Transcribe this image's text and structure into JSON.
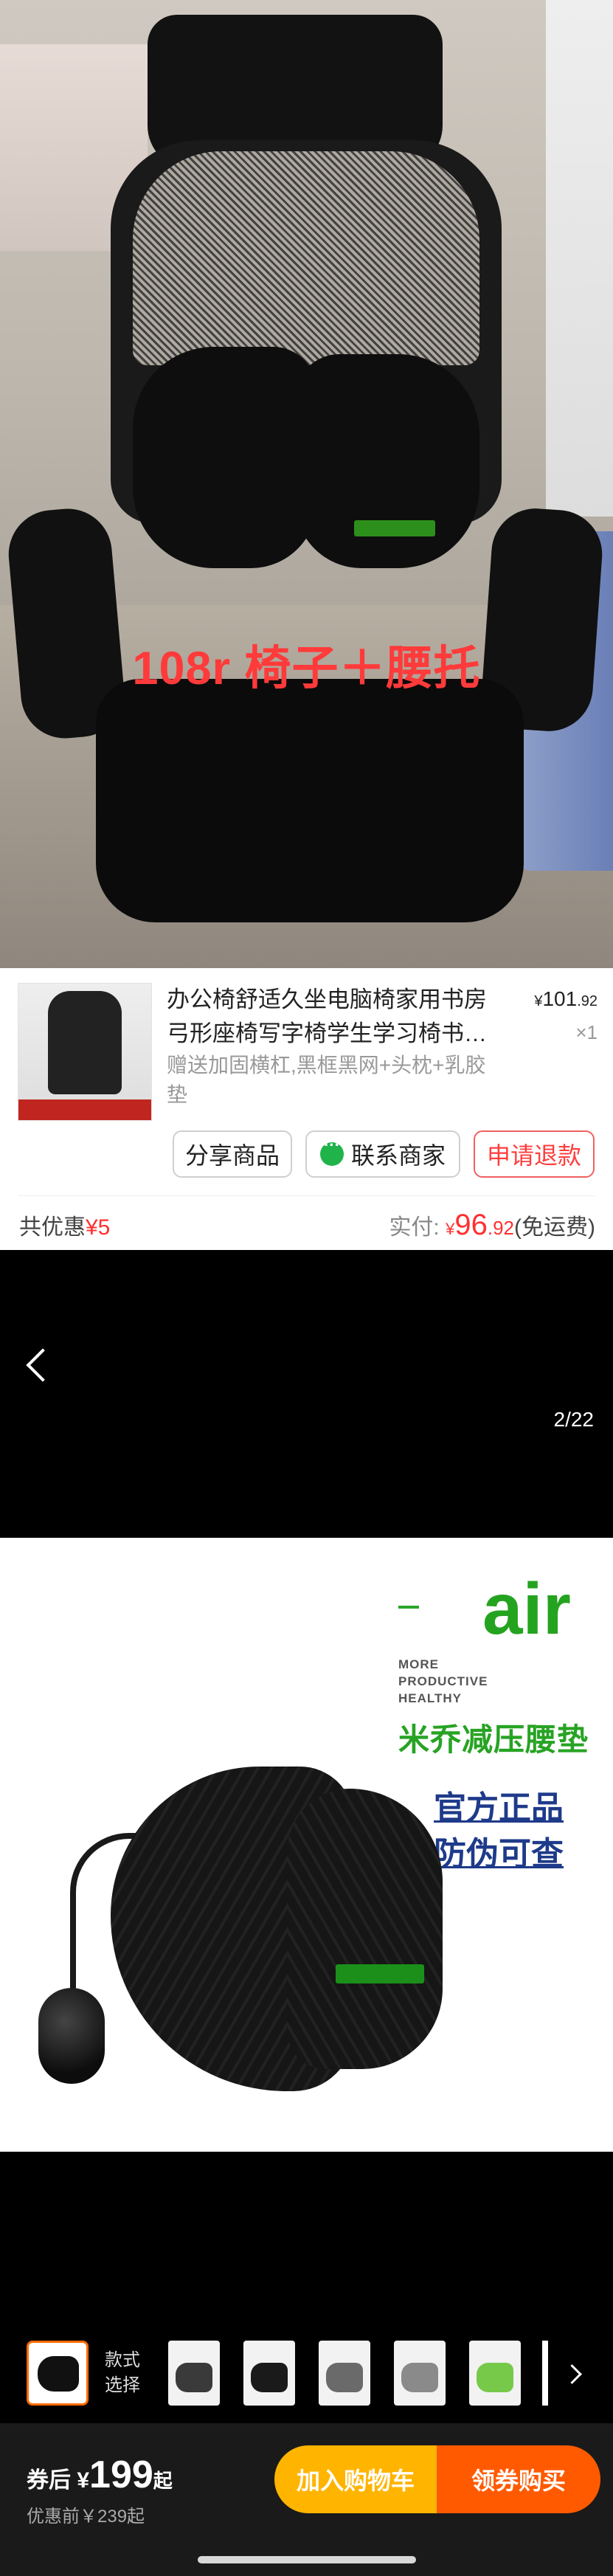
{
  "hero": {
    "caption": "108r 椅子＋腰托"
  },
  "order": {
    "title": "办公椅舒适久坐电脑椅家用书房弓形座椅写字椅学生学习椅书…",
    "spec": "赠送加固横杠,黑框黑网+头枕+乳胶垫",
    "price_currency": "¥",
    "price_int": "101",
    "price_dec": ".92",
    "quantity": "×1",
    "share_button": "分享商品",
    "contact_button": "联系商家",
    "refund_button": "申请退款",
    "discount_label": "共优惠",
    "discount_value": "¥5",
    "paid_label": "实付: ",
    "paid_currency": "¥",
    "paid_int": "96",
    "paid_dec": ".92",
    "paid_note": "(免运费)"
  },
  "viewer": {
    "counter": "2/22"
  },
  "product_image": {
    "dash": "–",
    "brand_word": "air",
    "tagline": [
      "MORE",
      "PRODUCTIVE",
      "HEALTHY"
    ],
    "title": "米乔减压腰垫",
    "badge1": "官方正品",
    "badge2": "防伪可查"
  },
  "style_strip": {
    "label_line1": "款式",
    "label_line2": "选择",
    "thumbnail_colors": [
      "#3a3a3a",
      "#1a1a1a",
      "#6a6a6a",
      "#8a8a8a",
      "#77c94a"
    ]
  },
  "buybar": {
    "coupon_prefix": "券后",
    "coupon_currency": "¥",
    "coupon_price": "199",
    "coupon_suffix": "起",
    "before_price": "优惠前￥239起",
    "cart_button": "加入购物车",
    "buy_button": "领券购买"
  },
  "colors": {
    "accent_red": "#ff3030",
    "brand_green": "#24a31f",
    "cart_yellow": "#ffb400",
    "buy_orange": "#ff5a00"
  }
}
